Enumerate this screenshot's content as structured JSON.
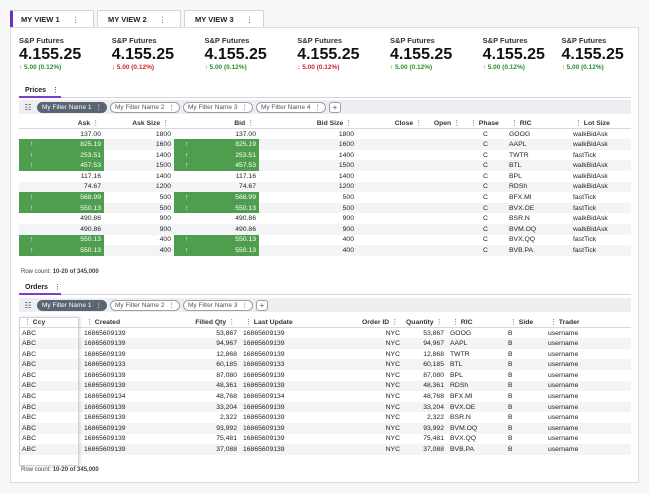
{
  "view_tabs": [
    {
      "label": "MY VIEW 1",
      "menu": "⋮"
    },
    {
      "label": "MY VIEW 2",
      "menu": "⋮"
    },
    {
      "label": "MY VIEW 3",
      "menu": "⋮"
    }
  ],
  "cards": [
    {
      "label": "S&P Futures",
      "price": "4.155.25",
      "change": "↑ 5.00 (0.12%)",
      "dir": "up"
    },
    {
      "label": "S&P Futures",
      "price": "4.155.25",
      "change": "↓ 5.00 (0.12%)",
      "dir": "down"
    },
    {
      "label": "S&P Futures",
      "price": "4.155.25",
      "change": "↑ 5.00 (0.12%)",
      "dir": "up"
    },
    {
      "label": "S&P Futures",
      "price": "4.155.25",
      "change": "↓ 5.00 (0.12%)",
      "dir": "down"
    },
    {
      "label": "S&P Futures",
      "price": "4.155.25",
      "change": "↑ 5.00 (0.12%)",
      "dir": "up"
    },
    {
      "label": "S&P Futures",
      "price": "4.155.25",
      "change": "↑ 5.00 (0.12%)",
      "dir": "up"
    },
    {
      "label": "S&P Futures",
      "price": "4.155.25",
      "change": "↑ 5.00 (0.12%)",
      "dir": "up"
    }
  ],
  "prices": {
    "tab": "Prices",
    "filters": [
      "My Filter Name 1",
      "My Filter Name 2",
      "My Filter Name 3",
      "My Filter Name 4"
    ],
    "columns": [
      "Ask",
      "Ask Size",
      "Bid",
      "Bid Size",
      "Close",
      "Open",
      "Phase",
      "RIC",
      "Lot Size"
    ],
    "rows": [
      [
        "137.00",
        "1800",
        "137.00",
        "1800",
        "",
        "",
        "C",
        "GOOG",
        "walkBidAsk"
      ],
      [
        "825.19",
        "1600",
        "825.19",
        "1600",
        "",
        "",
        "C",
        "AAPL",
        "walkBidAsk"
      ],
      [
        "253.51",
        "1400",
        "253.51",
        "1400",
        "",
        "",
        "C",
        "TWTR",
        "fastTick"
      ],
      [
        "457.53",
        "1500",
        "457.53",
        "1500",
        "",
        "",
        "C",
        "BTL",
        "walkBidAsk"
      ],
      [
        "117.16",
        "1400",
        "117.16",
        "1400",
        "",
        "",
        "C",
        "BPL",
        "walkBidAsk"
      ],
      [
        "74.67",
        "1200",
        "74.67",
        "1200",
        "",
        "",
        "C",
        "RDSh",
        "walkBidAsk"
      ],
      [
        "568.99",
        "500",
        "568.99",
        "500",
        "",
        "",
        "C",
        "BFX.MI",
        "fastTick"
      ],
      [
        "550.13",
        "500",
        "550.13",
        "500",
        "",
        "",
        "C",
        "BVX.OE",
        "fastTick"
      ],
      [
        "490.86",
        "900",
        "490.86",
        "900",
        "",
        "",
        "C",
        "BSR.N",
        "walkBidAsk"
      ],
      [
        "490.86",
        "900",
        "490.86",
        "900",
        "",
        "",
        "C",
        "BVM.OQ",
        "walkBidAsk"
      ],
      [
        "550.13",
        "400",
        "550.13",
        "400",
        "",
        "",
        "C",
        "BVX.QQ",
        "fastTick"
      ],
      [
        "550.13",
        "400",
        "550.13",
        "400",
        "",
        "",
        "C",
        "BVB.PA",
        "fastTick"
      ]
    ],
    "highlight_rows": [
      1,
      2,
      3,
      6,
      7,
      10,
      11
    ],
    "row_count_label": "Row count:",
    "row_count": "10-20 of 345,000"
  },
  "orders": {
    "tab": "Orders",
    "filters": [
      "My Filter Name 1",
      "My Filter Name 2",
      "My Filter Name 3"
    ],
    "columns": [
      "Ccy",
      "Created",
      "Filled Qty",
      "Last Update",
      "Order ID",
      "Quantity",
      "RIC",
      "Side",
      "Trader"
    ],
    "rows": [
      [
        "ABC",
        "16865609139",
        "53,867",
        "16865609139",
        "NYC",
        "53,867",
        "GOOG",
        "B",
        "username"
      ],
      [
        "ABC",
        "16865609139",
        "94,967",
        "16865609139",
        "NYC",
        "94,967",
        "AAPL",
        "B",
        "username"
      ],
      [
        "ABC",
        "16865609139",
        "12,868",
        "16865609139",
        "NYC",
        "12,868",
        "TWTR",
        "B",
        "username"
      ],
      [
        "ABC",
        "16865609133",
        "60,185",
        "16865609133",
        "NYC",
        "60,185",
        "BTL",
        "B",
        "username"
      ],
      [
        "ABC",
        "16865609139",
        "87,080",
        "16865609139",
        "NYC",
        "87,080",
        "BPL",
        "B",
        "username"
      ],
      [
        "ABC",
        "16865609139",
        "48,361",
        "16865609139",
        "NYC",
        "48,361",
        "RDSh",
        "B",
        "username"
      ],
      [
        "ABC",
        "16865609134",
        "48,768",
        "16865609134",
        "NYC",
        "48,768",
        "BFX.MI",
        "B",
        "username"
      ],
      [
        "ABC",
        "16865609139",
        "33,204",
        "16865609139",
        "NYC",
        "33,204",
        "BVX.OE",
        "B",
        "username"
      ],
      [
        "ABC",
        "16865609139",
        "2,322",
        "16865609139",
        "NYC",
        "2,322",
        "BSR.N",
        "B",
        "username"
      ],
      [
        "ABC",
        "16865609139",
        "93,992",
        "16865609139",
        "NYC",
        "93,992",
        "BVM.OQ",
        "B",
        "username"
      ],
      [
        "ABC",
        "16865609139",
        "75,481",
        "16865609139",
        "NYC",
        "75,481",
        "BVX.QQ",
        "B",
        "username"
      ],
      [
        "ABC",
        "16865609139",
        "37,088",
        "16865609139",
        "NYC",
        "37,088",
        "BVB.PA",
        "B",
        "username"
      ]
    ],
    "row_count_label": "Row count:",
    "row_count": "10-20 of 345,000"
  },
  "colors": {
    "accent": "#6b2fc2",
    "up": "#2c8a2c",
    "down": "#c62828",
    "highlight": "#4f9e4f"
  },
  "icons": {
    "menu": "kebab-icon",
    "filter": "filter-icon",
    "close": "close-icon",
    "add": "add-icon",
    "up": "arrow-up-icon",
    "down": "arrow-down-icon"
  }
}
